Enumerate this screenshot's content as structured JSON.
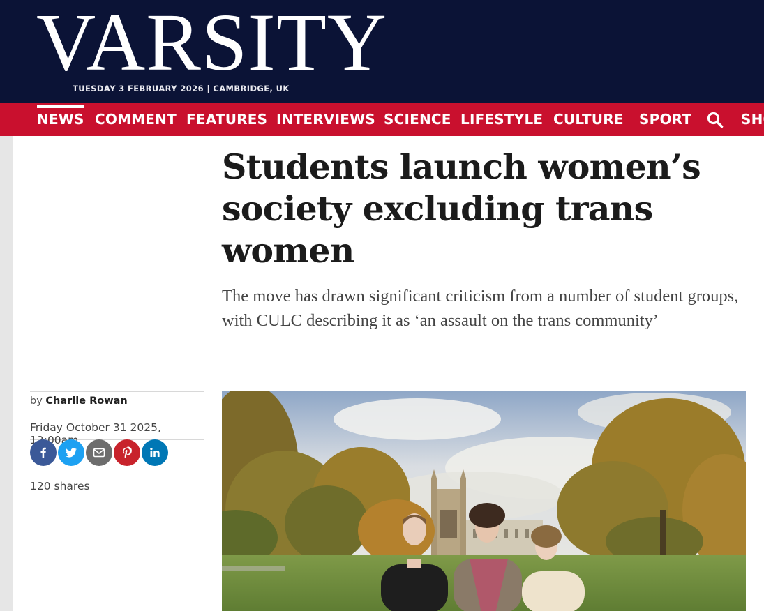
{
  "masthead": {
    "logo_text": "VARSITY",
    "dateline": "TUESDAY 3 FEBRUARY 2026 | CAMBRIDGE, UK"
  },
  "nav": {
    "items": [
      {
        "label": "NEWS",
        "active": true
      },
      {
        "label": "COMMENT"
      },
      {
        "label": "FEATURES"
      },
      {
        "label": "INTERVIEWS"
      },
      {
        "label": "SCIENCE"
      },
      {
        "label": "LIFESTYLE"
      },
      {
        "label": "CULTURE"
      },
      {
        "label": "SPORT"
      },
      {
        "label": "SHO"
      }
    ],
    "search_icon": "search-icon"
  },
  "article": {
    "headline": "Students launch women’s society excluding trans women",
    "standfirst": "The move has drawn significant criticism from a number of student groups, with CULC describing it as ‘an assault on the trans community’",
    "byline_prefix": "by",
    "author": "Charlie Rowan",
    "date": "Friday October 31 2025, 12:00am",
    "share_count": "120 shares"
  },
  "share_buttons": [
    {
      "name": "facebook",
      "icon": "facebook-icon",
      "color": "#3b5998"
    },
    {
      "name": "twitter",
      "icon": "twitter-icon",
      "color": "#1da1f2"
    },
    {
      "name": "email",
      "icon": "email-icon",
      "color": "#6d6d6d"
    },
    {
      "name": "pinterest",
      "icon": "pinterest-icon",
      "color": "#c8232c"
    },
    {
      "name": "linkedin",
      "icon": "linkedin-icon",
      "color": "#0077b5"
    }
  ],
  "colors": {
    "masthead_bg": "#0b1336",
    "nav_bg": "#c9102e"
  }
}
